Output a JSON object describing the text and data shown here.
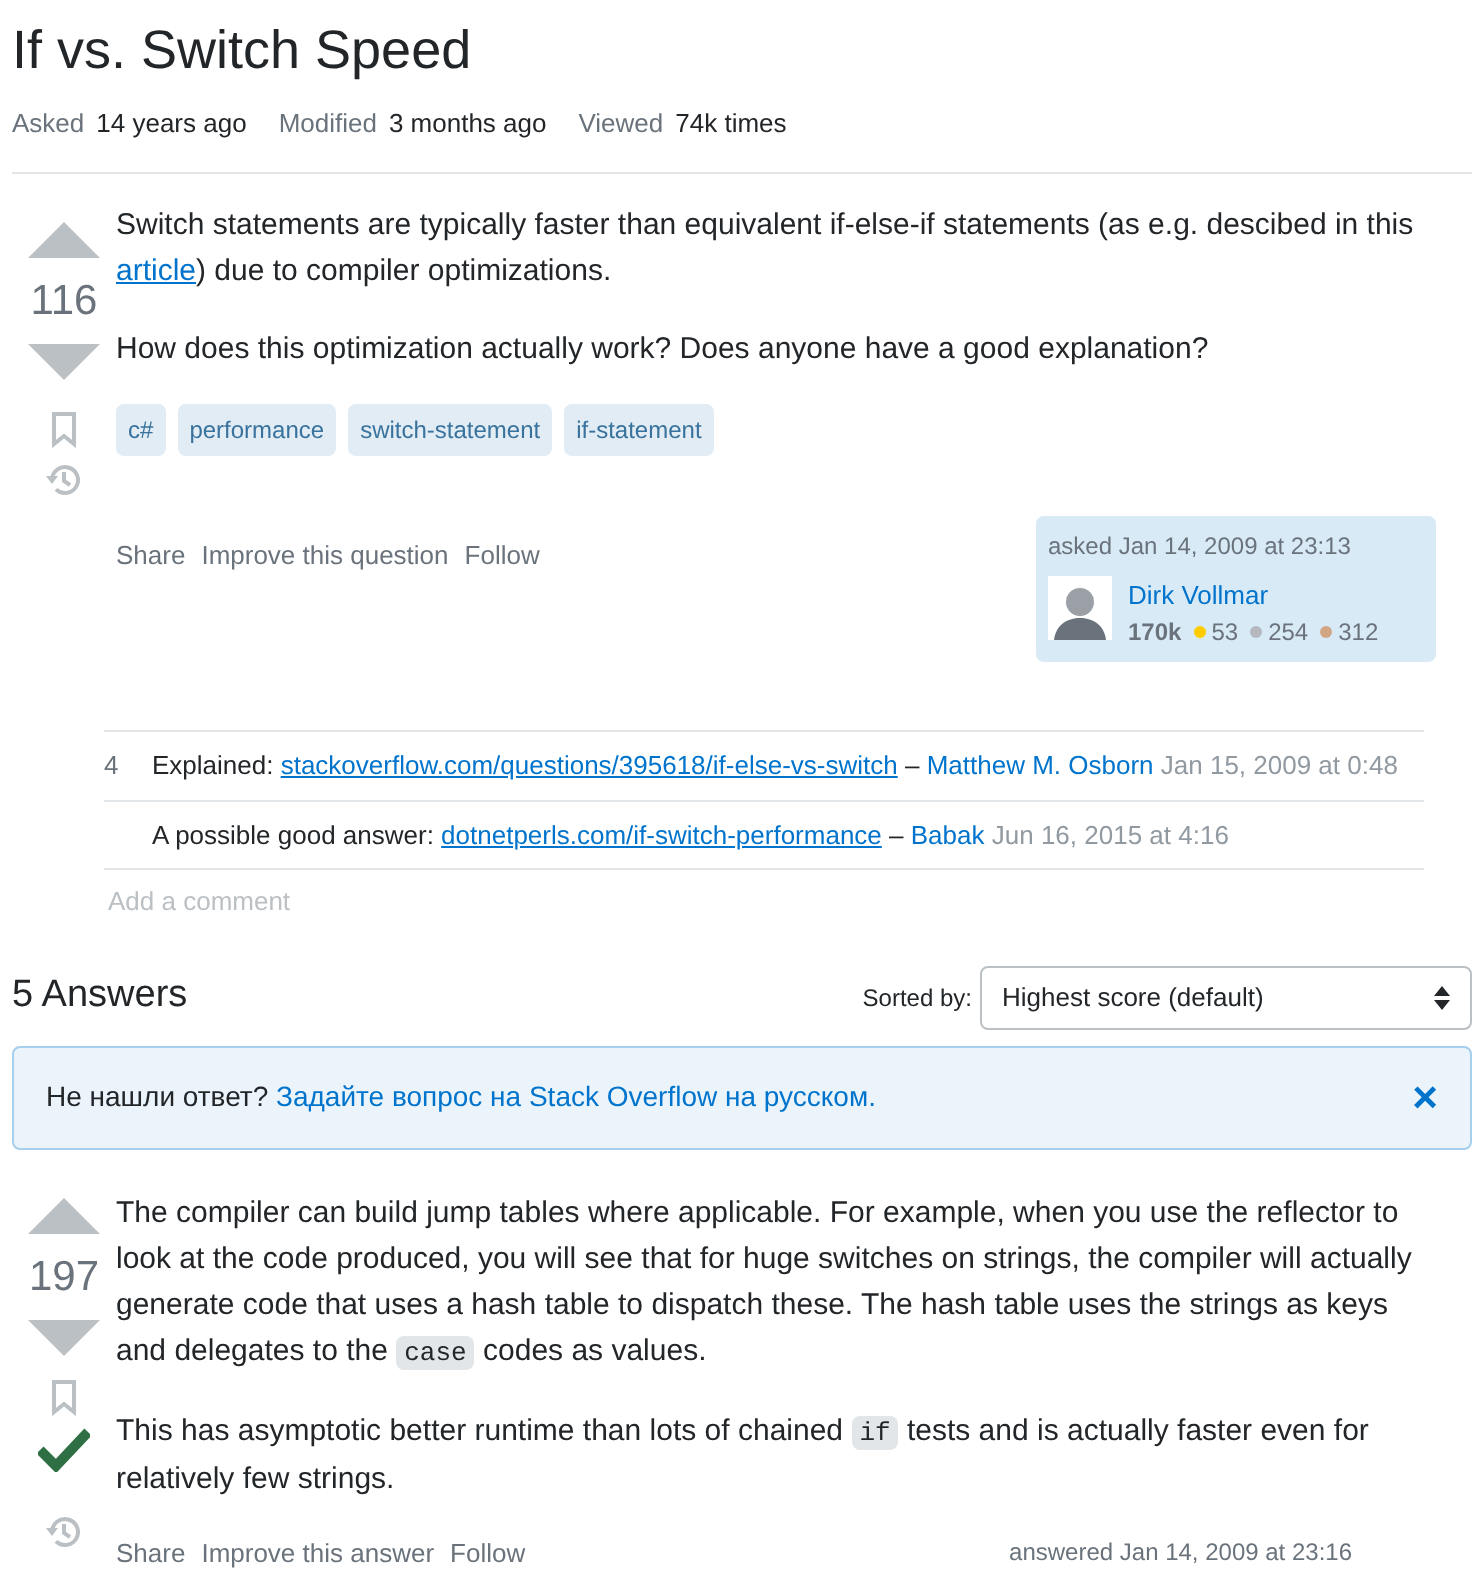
{
  "question": {
    "title": "If vs. Switch Speed",
    "meta": [
      {
        "label": "Asked",
        "value": "14 years ago"
      },
      {
        "label": "Modified",
        "value": "3 months ago"
      },
      {
        "label": "Viewed",
        "value": "74k times"
      }
    ],
    "score": "116",
    "body": [
      [
        {
          "kind": "text",
          "text": "Switch statements are typically faster than equivalent if-else-if statements (as e.g. descibed in this "
        },
        {
          "kind": "link",
          "text": "article"
        },
        {
          "kind": "text",
          "text": ") due to compiler optimizations."
        }
      ],
      [
        {
          "kind": "text",
          "text": "How does this optimization actually work? Does anyone have a good explanation?"
        }
      ]
    ],
    "tags": [
      "c#",
      "performance",
      "switch-statement",
      "if-statement"
    ],
    "actions": [
      "Share",
      "Improve this question",
      "Follow"
    ],
    "owner": {
      "caption": "asked Jan 14, 2009 at 23:13",
      "name": "Dirk Vollmar",
      "reputation": "170k",
      "badges": [
        {
          "color": "#ffcc01",
          "count": "53"
        },
        {
          "color": "#b4b8bc",
          "count": "254"
        },
        {
          "color": "#d1a684",
          "count": "312"
        }
      ]
    },
    "comments": [
      {
        "score": "4",
        "parts": [
          {
            "kind": "text",
            "text": "Explained: "
          },
          {
            "kind": "link",
            "text": "stackoverflow.com/questions/395618/if-else-vs-switch"
          },
          {
            "kind": "text",
            "text": " – "
          }
        ],
        "author": "Matthew M. Osborn",
        "date": "Jan 15, 2009 at 0:48"
      },
      {
        "parts": [
          {
            "kind": "text",
            "text": "A possible good answer: "
          },
          {
            "kind": "link",
            "text": "dotnetperls.com/if-switch-performance"
          },
          {
            "kind": "text",
            "text": " – "
          }
        ],
        "author": "Babak",
        "date": "Jun 16, 2015 at 4:16"
      }
    ],
    "add_comment": "Add a comment"
  },
  "answers_header": {
    "title": "5 Answers",
    "sort_label": "Sorted by:",
    "sort_value": "Highest score (default)"
  },
  "notice": {
    "text": "Не нашли ответ? ",
    "link": "Задайте вопрос на Stack Overflow на русском.",
    "close": "×"
  },
  "answer": {
    "score": "197",
    "accepted": true,
    "body": [
      [
        {
          "kind": "text",
          "text": "The compiler can build jump tables where applicable. For example, when you use the reflector to look at the code produced, you will see that for huge switches on strings, the compiler will actually generate code that uses a hash table to dispatch these. The hash table uses the strings as keys and delegates to the "
        },
        {
          "kind": "code",
          "text": "case"
        },
        {
          "kind": "text",
          "text": " codes as values."
        }
      ],
      [
        {
          "kind": "text",
          "text": "This has asymptotic better runtime than lots of chained "
        },
        {
          "kind": "code",
          "text": "if"
        },
        {
          "kind": "text",
          "text": " tests and is actually faster even for relatively few strings."
        }
      ]
    ],
    "actions": [
      "Share",
      "Improve this answer",
      "Follow"
    ],
    "caption": "answered Jan 14, 2009 at 23:16"
  }
}
